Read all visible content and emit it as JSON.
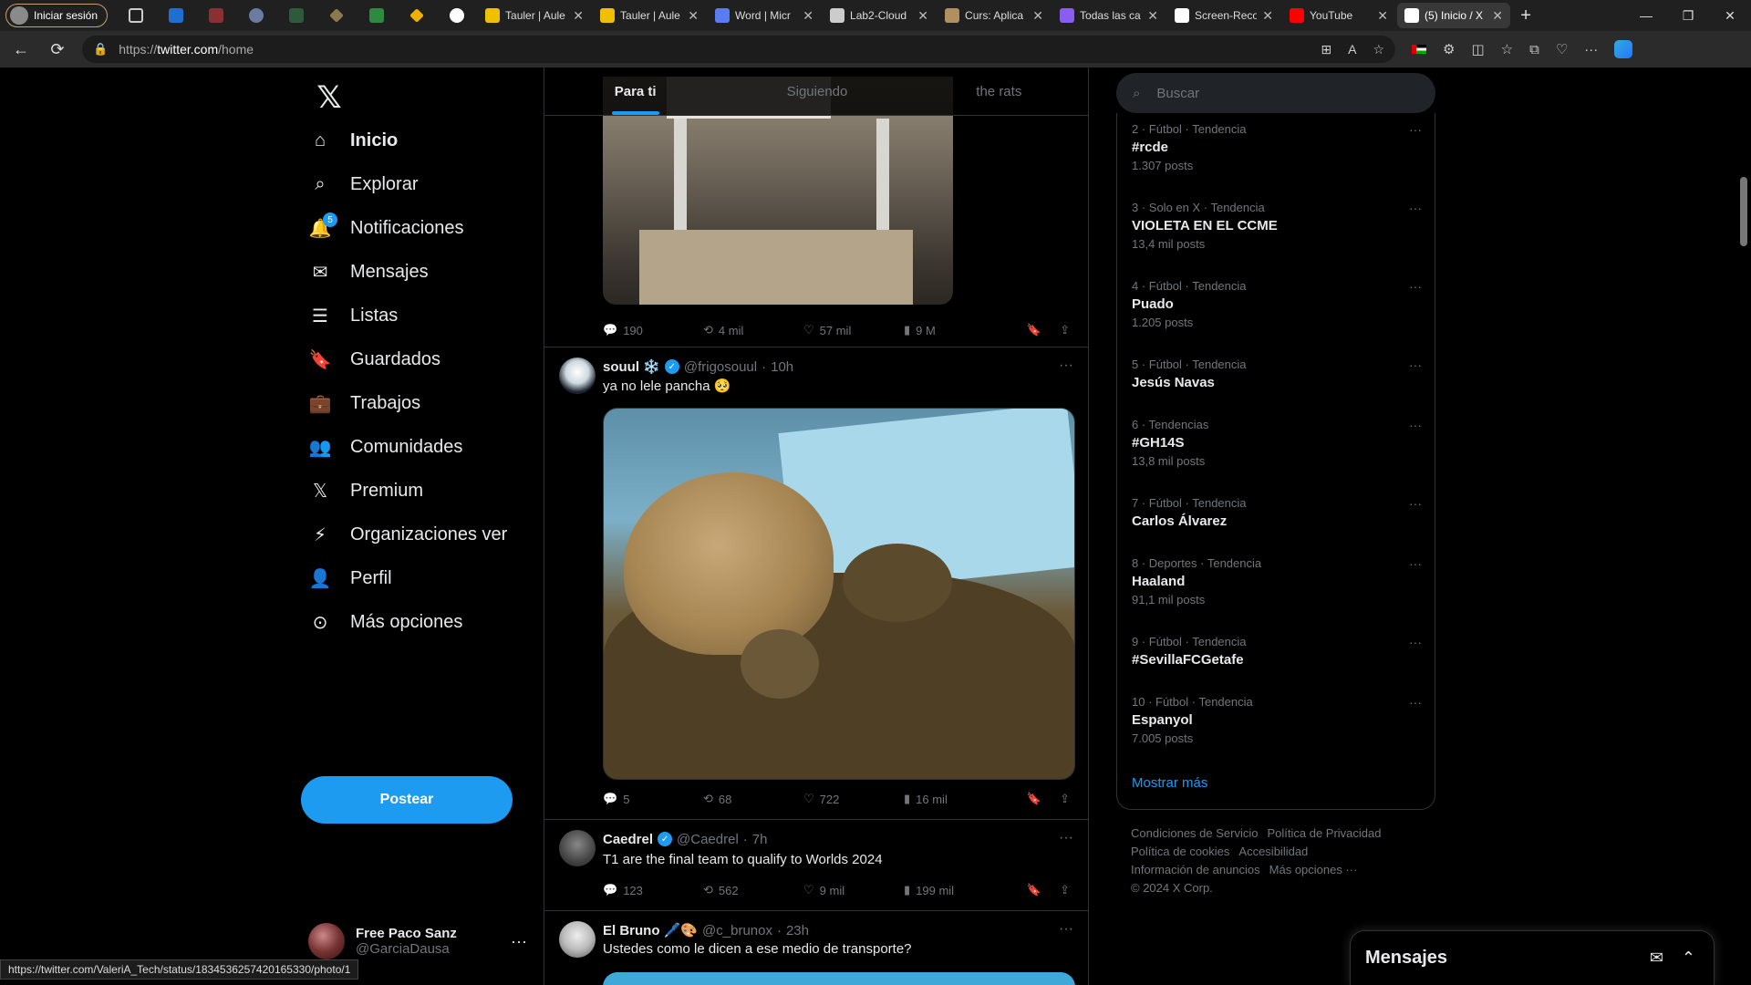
{
  "browser": {
    "profile_label": "Iniciar sesión",
    "tabs": [
      {
        "title": "Tauler | Aule",
        "color": "#f0c000"
      },
      {
        "title": "Tauler | Aule",
        "color": "#f0c000"
      },
      {
        "title": "Word | Micr",
        "color": "#5b7cf0"
      },
      {
        "title": "Lab2-Cloud",
        "color": "#cccccc"
      },
      {
        "title": "Curs: Aplica",
        "color": "#b09060"
      },
      {
        "title": "Todas las ca",
        "color": "#8a5cf0"
      },
      {
        "title": "Screen-Reco",
        "color": "#ffffff"
      },
      {
        "title": "YouTube",
        "color": "#ff0000"
      },
      {
        "title": "(5) Inicio / X",
        "color": "#ffffff"
      }
    ],
    "url_prefix": "https://",
    "url_domain": "twitter.com",
    "url_path": "/home",
    "status_url": "https://twitter.com/ValeriA_Tech/status/1834536257420165330/photo/1"
  },
  "nav": {
    "items": [
      {
        "label": "Inicio",
        "icon": "home-icon"
      },
      {
        "label": "Explorar",
        "icon": "search-icon"
      },
      {
        "label": "Notificaciones",
        "icon": "bell-icon",
        "badge": "5"
      },
      {
        "label": "Mensajes",
        "icon": "mail-icon"
      },
      {
        "label": "Listas",
        "icon": "list-icon"
      },
      {
        "label": "Guardados",
        "icon": "bookmark-icon"
      },
      {
        "label": "Trabajos",
        "icon": "briefcase-icon"
      },
      {
        "label": "Comunidades",
        "icon": "people-icon"
      },
      {
        "label": "Premium",
        "icon": "x-icon"
      },
      {
        "label": "Organizaciones ver",
        "icon": "lightning-icon"
      },
      {
        "label": "Perfil",
        "icon": "person-icon"
      },
      {
        "label": "Más opciones",
        "icon": "more-circle-icon"
      }
    ],
    "post_button": "Postear",
    "account": {
      "display_name": "Free Paco Sanz",
      "username": "@GarciaDausa"
    }
  },
  "timeline": {
    "tabs": [
      "Para ti",
      "Siguiendo",
      "the rats"
    ],
    "tweet1": {
      "replies": "190",
      "retweets": "4 mil",
      "likes": "57 mil",
      "views": "9 M"
    },
    "tweet2": {
      "name": "souul ❄️",
      "handle": "@frigosouul",
      "time": "10h",
      "text": "ya no lele pancha 🥺",
      "replies": "5",
      "retweets": "68",
      "likes": "722",
      "views": "16 mil"
    },
    "tweet3": {
      "name": "Caedrel",
      "handle": "@Caedrel",
      "time": "7h",
      "text": "T1 are the final team to qualify to Worlds 2024",
      "replies": "123",
      "retweets": "562",
      "likes": "9 mil",
      "views": "199 mil"
    },
    "tweet4": {
      "name": "El Bruno 🖊️🎨",
      "handle": "@c_brunox",
      "time": "23h",
      "text": "Ustedes como le dicen a ese medio de transporte?"
    }
  },
  "sidebar": {
    "search_placeholder": "Buscar",
    "trends": [
      {
        "meta": "2 · Fútbol · Tendencia",
        "name": "#rcde",
        "count": "1.307 posts"
      },
      {
        "meta": "3 · Solo en X · Tendencia",
        "name": "VIOLETA EN EL CCME",
        "count": "13,4 mil posts"
      },
      {
        "meta": "4 · Fútbol · Tendencia",
        "name": "Puado",
        "count": "1.205 posts"
      },
      {
        "meta": "5 · Fútbol · Tendencia",
        "name": "Jesús Navas",
        "count": ""
      },
      {
        "meta": "6 · Tendencias",
        "name": "#GH14S",
        "count": "13,8 mil posts"
      },
      {
        "meta": "7 · Fútbol · Tendencia",
        "name": "Carlos Álvarez",
        "count": ""
      },
      {
        "meta": "8 · Deportes · Tendencia",
        "name": "Haaland",
        "count": "91,1 mil posts"
      },
      {
        "meta": "9 · Fútbol · Tendencia",
        "name": "#SevillaFCGetafe",
        "count": ""
      },
      {
        "meta": "10 · Fútbol · Tendencia",
        "name": "Espanyol",
        "count": "7.005 posts"
      }
    ],
    "show_more": "Mostrar más",
    "footer": [
      "Condiciones de Servicio",
      "Política de Privacidad",
      "Política de cookies",
      "Accesibilidad",
      "Información de anuncios",
      "Más opciones ···",
      "© 2024 X Corp."
    ]
  },
  "messages_drawer": {
    "title": "Mensajes"
  }
}
